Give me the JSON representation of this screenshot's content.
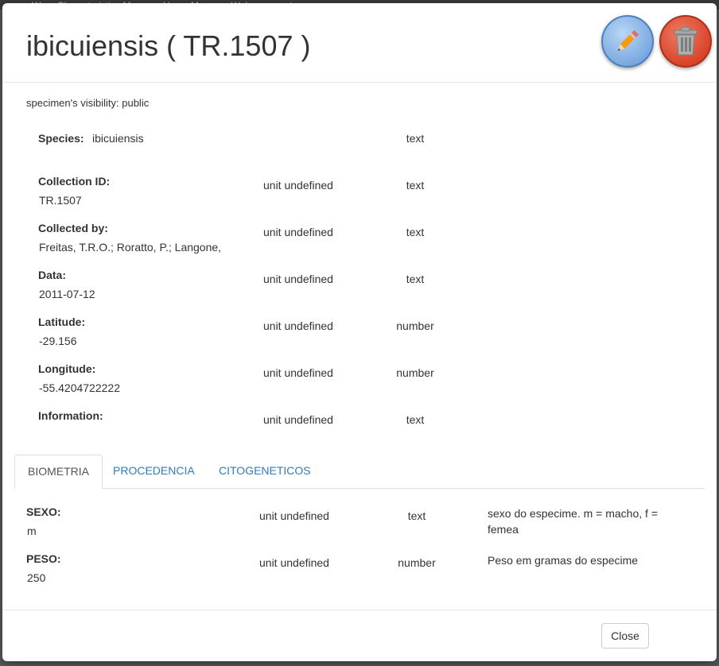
{
  "background": {
    "sliver_text": "Wora    Characteristics Manager    Users Manager    Welcome marina"
  },
  "modal": {
    "title": "ibicuiensis ( TR.1507 )",
    "visibility_text": "specimen's visibility: public",
    "edit_icon": "pencil-icon",
    "delete_icon": "trash-icon",
    "colors": {
      "edit": "#7ba9e0",
      "delete": "#d8452b",
      "link": "#337ab7"
    }
  },
  "species_field": {
    "label": "Species:",
    "value": "ibicuiensis",
    "type": "text"
  },
  "fields": [
    {
      "label": "Collection ID:",
      "value": "TR.1507",
      "unit": "unit undefined",
      "type": "text"
    },
    {
      "label": "Collected by:",
      "value": "Freitas, T.R.O.; Roratto, P.; Langone,",
      "unit": "unit undefined",
      "type": "text"
    },
    {
      "label": "Data:",
      "value": "2011-07-12",
      "unit": "unit undefined",
      "type": "text"
    },
    {
      "label": "Latitude:",
      "value": "-29.156",
      "unit": "unit undefined",
      "type": "number"
    },
    {
      "label": "Longitude:",
      "value": "-55.4204722222",
      "unit": "unit undefined",
      "type": "number"
    },
    {
      "label": "Information:",
      "value": "",
      "unit": "unit undefined",
      "type": "text"
    }
  ],
  "tabs": [
    {
      "label": "BIOMETRIA",
      "active": true
    },
    {
      "label": "PROCEDENCIA",
      "active": false
    },
    {
      "label": "CITOGENETICOS",
      "active": false
    }
  ],
  "biometria": [
    {
      "label": "SEXO:",
      "value": "m",
      "unit": "unit undefined",
      "type": "text",
      "description": "sexo do especime. m = macho, f = femea"
    },
    {
      "label": "PESO:",
      "value": "250",
      "unit": "unit undefined",
      "type": "number",
      "description": "Peso em gramas do especime"
    }
  ],
  "footer": {
    "close_label": "Close"
  }
}
